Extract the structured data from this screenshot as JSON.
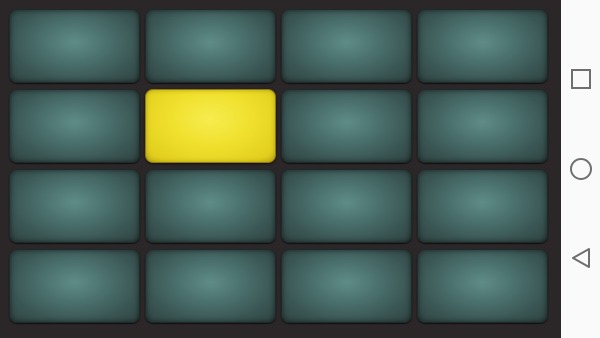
{
  "pad_grid": {
    "rows": 4,
    "columns": 4,
    "active_pad": {
      "row": 2,
      "column": 2
    },
    "colors": {
      "pad": "#4b716e",
      "active_pad": "#f0e02d",
      "background": "#2b2628"
    }
  },
  "navigation_bar": {
    "buttons": [
      {
        "name": "recents-button",
        "icon": "square-icon"
      },
      {
        "name": "home-button",
        "icon": "circle-icon"
      },
      {
        "name": "back-button",
        "icon": "triangle-back-icon"
      }
    ],
    "colors": {
      "background": "#fafafa",
      "icon": "#6f6f6f"
    }
  }
}
